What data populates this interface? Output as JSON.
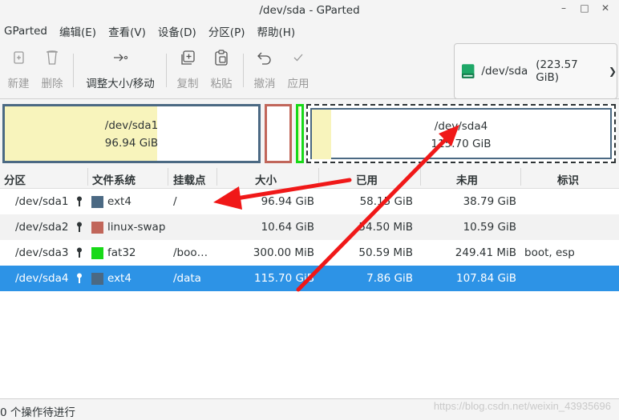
{
  "window": {
    "title": "/dev/sda - GParted"
  },
  "menu": [
    "GParted",
    "编辑(E)",
    "查看(V)",
    "设备(D)",
    "分区(P)",
    "帮助(H)"
  ],
  "toolbar": {
    "new": "新建",
    "delete": "删除",
    "resize": "调整大小/移动",
    "copy": "复制",
    "paste": "粘贴",
    "undo": "撤消",
    "apply": "应用"
  },
  "device": {
    "name": "/dev/sda",
    "size": "(223.57 GiB)"
  },
  "diskmap": {
    "sda1": {
      "name": "/dev/sda1",
      "size": "96.94 GiB"
    },
    "sda4": {
      "name": "/dev/sda4",
      "size": "115.70 GiB"
    }
  },
  "columns": [
    "分区",
    "文件系统",
    "挂载点",
    "大小",
    "已用",
    "未用",
    "标识"
  ],
  "partitions": [
    {
      "name": "/dev/sda1",
      "fs": "ext4",
      "fs_color": "#4b6983",
      "mount": "/",
      "size": "96.94 GiB",
      "used": "58.15 GiB",
      "unused": "38.79 GiB",
      "flags": ""
    },
    {
      "name": "/dev/sda2",
      "fs": "linux-swap",
      "fs_color": "#c1665a",
      "mount": "",
      "size": "10.64 GiB",
      "used": "54.50 MiB",
      "unused": "10.59 GiB",
      "flags": ""
    },
    {
      "name": "/dev/sda3",
      "fs": "fat32",
      "fs_color": "#18d918",
      "mount": "/boo…",
      "size": "300.00 MiB",
      "used": "50.59 MiB",
      "unused": "249.41 MiB",
      "flags": "boot, esp"
    },
    {
      "name": "/dev/sda4",
      "fs": "ext4",
      "fs_color": "#4b6983",
      "mount": "/data",
      "size": "115.70 GiB",
      "used": "7.86 GiB",
      "unused": "107.84 GiB",
      "flags": ""
    }
  ],
  "status": "0 个操作待进行",
  "watermark": "https://blog.csdn.net/weixin_43935696"
}
